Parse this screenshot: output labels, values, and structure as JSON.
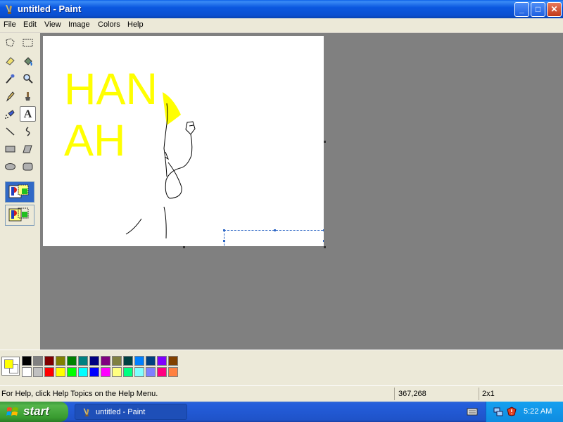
{
  "window": {
    "title": "untitled - Paint",
    "buttons": {
      "minimize": "_",
      "maximize": "□",
      "close": "✕"
    }
  },
  "menu": [
    "File",
    "Edit",
    "View",
    "Image",
    "Colors",
    "Help"
  ],
  "toolbox": {
    "tools": [
      {
        "name": "free-form-select-icon"
      },
      {
        "name": "rect-select-icon"
      },
      {
        "name": "eraser-icon"
      },
      {
        "name": "fill-bucket-icon"
      },
      {
        "name": "color-picker-icon"
      },
      {
        "name": "magnifier-icon"
      },
      {
        "name": "pencil-icon"
      },
      {
        "name": "brush-icon"
      },
      {
        "name": "airbrush-icon"
      },
      {
        "name": "text-tool-icon",
        "glyph": "A",
        "active": true
      },
      {
        "name": "line-icon"
      },
      {
        "name": "curve-icon"
      },
      {
        "name": "rectangle-icon"
      },
      {
        "name": "polygon-icon"
      },
      {
        "name": "ellipse-icon"
      },
      {
        "name": "rounded-rect-icon"
      }
    ],
    "text_options": [
      "opaque-background-option",
      "transparent-background-option"
    ],
    "selected_option": 0
  },
  "canvas": {
    "text_lines": [
      "HAN",
      "AH"
    ],
    "text_color": "#ffff00"
  },
  "palette": {
    "foreground": "#ffff00",
    "background": "#ffffff",
    "row1": [
      "#000000",
      "#808080",
      "#800000",
      "#808000",
      "#008000",
      "#008080",
      "#000080",
      "#800080",
      "#808040",
      "#004040",
      "#0080ff",
      "#004080",
      "#8000ff",
      "#804000"
    ],
    "row2": [
      "#ffffff",
      "#c0c0c0",
      "#ff0000",
      "#ffff00",
      "#00ff00",
      "#00ffff",
      "#0000ff",
      "#ff00ff",
      "#ffff80",
      "#00ff80",
      "#80ffff",
      "#8080ff",
      "#ff0080",
      "#ff8040"
    ]
  },
  "status": {
    "help_text": "For Help, click Help Topics on the Help Menu.",
    "cursor_position": "367,268",
    "selection_size": "2x1"
  },
  "taskbar": {
    "start_label": "start",
    "task_label": "untitled - Paint",
    "clock": "5:22 AM"
  }
}
